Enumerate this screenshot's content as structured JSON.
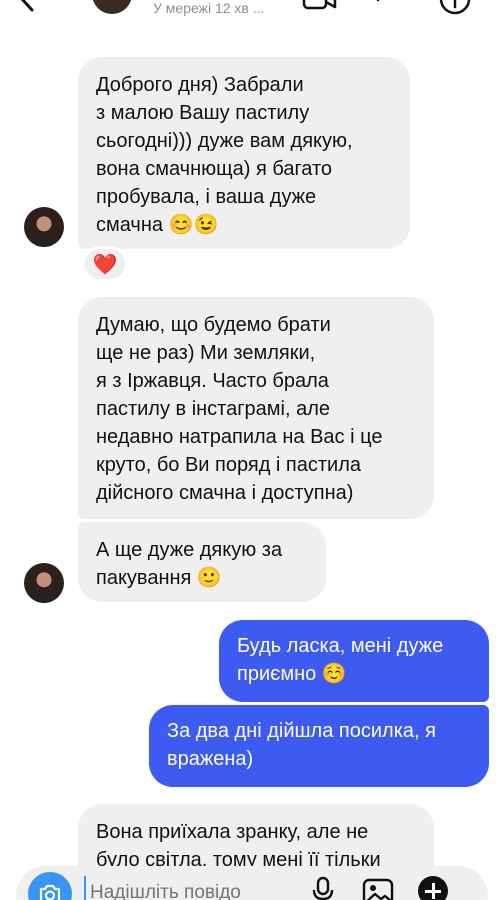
{
  "header": {
    "status": "У мережі 12 хв ..."
  },
  "messages": [
    {
      "from": "them",
      "text": "Доброго дня) Забрали\nз малою Вашу пастилу\nсьогодні))) дуже вам дякую,\nвона смачнюща) я багато\nпробувала, і ваша дуже\nсмачна 😊😉",
      "reaction": "❤️"
    },
    {
      "from": "them",
      "text": "Думаю, що будемо брати\nще не раз) Ми земляки,\nя з Іржавця. Часто брала\nпастилу в інстаграмі, але\nнедавно натрапила на Вас і це\nкруто, бо Ви поряд і пастила\nдійсного смачна і доступна)"
    },
    {
      "from": "them",
      "text": "А ще дуже дякую за\nпакування 🙂"
    },
    {
      "from": "me",
      "text": "Будь ласка, мені дуже\nприємно ☺️"
    },
    {
      "from": "me",
      "text": "За два дні дійшла посилка, я\nвражена)"
    },
    {
      "from": "them",
      "text": "Вона приїхала зранку, але не\nбуло світла, тому мені її тільки"
    }
  ],
  "composer": {
    "placeholder": "Надішліть повідо"
  },
  "icons": {
    "back": "back-arrow-icon",
    "video": "video-call-icon",
    "phone": "phone-icon",
    "info": "info-icon",
    "camera": "camera-icon",
    "mic": "microphone-icon",
    "image": "image-icon",
    "add": "plus-icon"
  },
  "colors": {
    "incoming_bubble": "#efefef",
    "outgoing_bubble": "#3d5af1",
    "camera_button": "#3797f0"
  }
}
